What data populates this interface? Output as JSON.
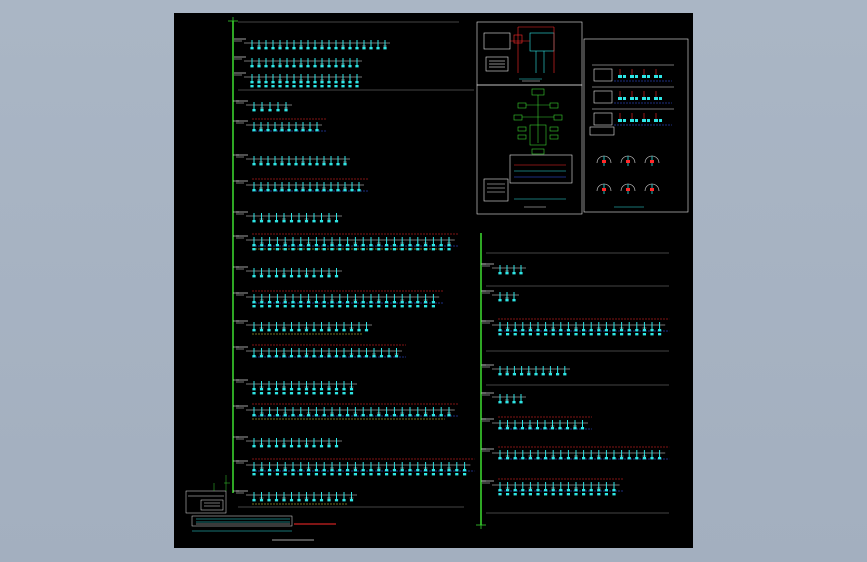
{
  "canvas": {
    "background": "#a8b4c4",
    "sheet_background": "#000000"
  },
  "palette": {
    "bus": "#39d12e",
    "cyan": "#2ee6e6",
    "white": "#e6e6e6",
    "red": "#ff2a2a",
    "blue": "#3a5cff",
    "yellow": "#e8e040",
    "gray": "#8a8a8a"
  },
  "drawing": {
    "title_block_caption": "",
    "plan_caption": ""
  }
}
